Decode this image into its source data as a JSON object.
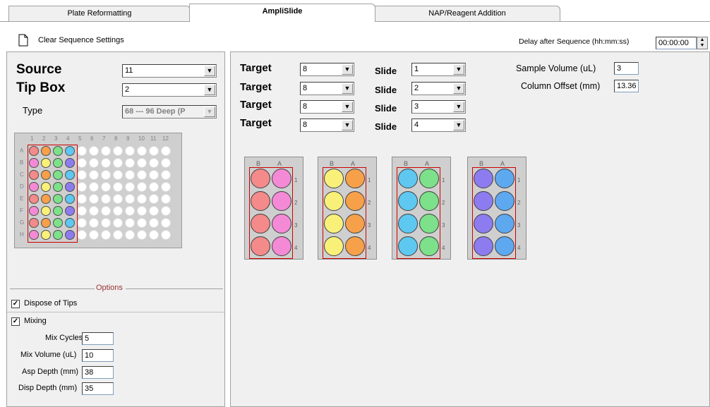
{
  "tabs": [
    {
      "label": "Plate Reformatting",
      "active": false
    },
    {
      "label": "AmpliSlide",
      "active": true
    },
    {
      "label": "NAP/Reagent Addition",
      "active": false
    }
  ],
  "toolbar": {
    "clear_label": "Clear Sequence Settings",
    "delay_label": "Delay after Sequence (hh:mm:ss)",
    "delay_value": "00:00:00"
  },
  "left": {
    "source_label": "Source",
    "source_value": "11",
    "tipbox_label": "Tip Box",
    "tipbox_value": "2",
    "type_label": "Type",
    "type_value": "68 --- 96 Deep (P",
    "plate": {
      "col_labels": [
        "1",
        "2",
        "3",
        "4",
        "5",
        "6",
        "7",
        "8",
        "9",
        "10",
        "11",
        "12"
      ],
      "row_labels": [
        "A",
        "B",
        "C",
        "D",
        "E",
        "F",
        "G",
        "H"
      ],
      "column_colors": [
        "#f48a8a",
        "#f9f07a",
        "#7de08a",
        "#5ec8f0"
      ],
      "row_overrides": {
        "A": [
          "#f48a8a",
          "#f7a04a",
          "#7de08a",
          "#5ec8f0"
        ],
        "C": [
          "#f48a8a",
          "#f7a04a",
          "#7de08a",
          "#5ec8f0"
        ],
        "E": [
          "#f48a8a",
          "#f7a04a",
          "#7de08a",
          "#5ec8f0"
        ],
        "G": [
          "#f48a8a",
          "#f7a04a",
          "#7de08a",
          "#5ec8f0"
        ],
        "B": [
          "#f48ad6",
          "#f9f07a",
          "#7de08a",
          "#8c7cf0"
        ],
        "D": [
          "#f48ad6",
          "#f9f07a",
          "#7de08a",
          "#8c7cf0"
        ],
        "F": [
          "#f48ad6",
          "#f9f07a",
          "#7de08a",
          "#8c7cf0"
        ],
        "H": [
          "#f48ad6",
          "#f9f07a",
          "#7de08a",
          "#8c7cf0"
        ]
      },
      "empty_color": "#ffffff"
    },
    "options_title": "Options",
    "dispose_label": "Dispose of Tips",
    "dispose_checked": true,
    "mixing_label": "Mixing",
    "mixing_checked": true,
    "mix_cycles_label": "Mix Cycles",
    "mix_cycles_value": "5",
    "mix_volume_label": "Mix Volume (uL)",
    "mix_volume_value": "10",
    "asp_depth_label": "Asp Depth (mm)",
    "asp_depth_value": "38",
    "disp_depth_label": "Disp Depth (mm)",
    "disp_depth_value": "35"
  },
  "right": {
    "targets": [
      {
        "label": "Target",
        "value": "8",
        "slide_label": "Slide",
        "slide_value": "1"
      },
      {
        "label": "Target",
        "value": "8",
        "slide_label": "Slide",
        "slide_value": "2"
      },
      {
        "label": "Target",
        "value": "8",
        "slide_label": "Slide",
        "slide_value": "3"
      },
      {
        "label": "Target",
        "value": "8",
        "slide_label": "Slide",
        "slide_value": "4"
      }
    ],
    "sample_volume_label": "Sample Volume (uL)",
    "sample_volume_value": "3",
    "column_offset_label": "Column Offset (mm)",
    "column_offset_value": "13.36",
    "slides": [
      {
        "header_b": "B",
        "header_a": "A",
        "color_b": "#f48a8a",
        "color_a": "#f48ad6",
        "row_nums": [
          "1",
          "2",
          "3",
          "4"
        ]
      },
      {
        "header_b": "B",
        "header_a": "A",
        "color_b": "#f9f07a",
        "color_a": "#f7a04a",
        "row_nums": [
          "1",
          "2",
          "3",
          "4"
        ]
      },
      {
        "header_b": "B",
        "header_a": "A",
        "color_b": "#5ec8f0",
        "color_a": "#7de08a",
        "row_nums": [
          "1",
          "2",
          "3",
          "4"
        ]
      },
      {
        "header_b": "B",
        "header_a": "A",
        "color_b": "#8c7cf0",
        "color_a": "#5ea8f0",
        "row_nums": [
          "1",
          "2",
          "3",
          "4"
        ]
      }
    ]
  }
}
